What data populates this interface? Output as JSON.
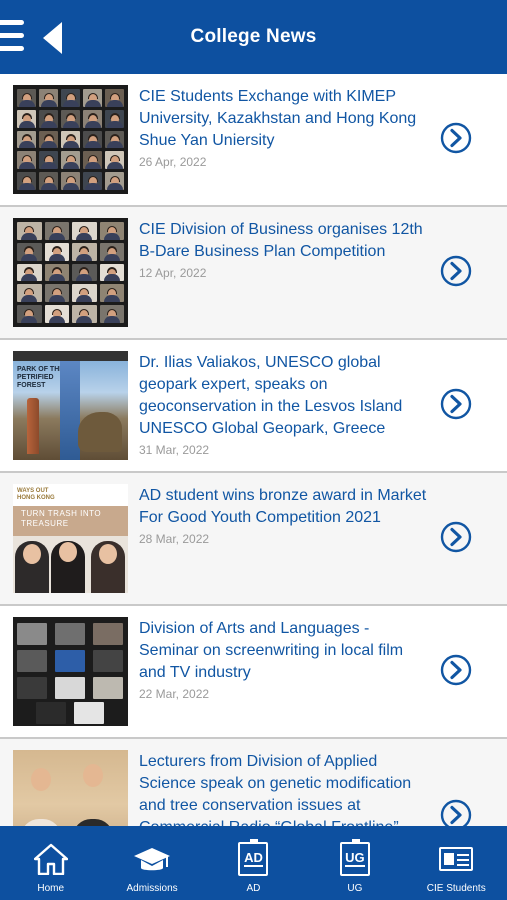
{
  "header": {
    "title": "College News",
    "menu_icon": "hamburger-icon",
    "back_icon": "back-arrow-icon"
  },
  "colors": {
    "brand": "#0d50a0",
    "title_text": "#1156a3",
    "date_text": "#9a9a9a"
  },
  "news": [
    {
      "title": "CIE Students Exchange with KIMEP University, Kazakhstan and Hong Kong Shue Yan Uniersity",
      "date": "26 Apr, 2022"
    },
    {
      "title": "CIE Division of Business organises 12th B-Dare Business Plan Competition",
      "date": "12 Apr, 2022"
    },
    {
      "title": "Dr. Ilias Valiakos, UNESCO global geopark expert, speaks on geoconservation in the Lesvos Island UNESCO Global Geopark, Greece",
      "date": "31 Mar, 2022"
    },
    {
      "title": "AD student wins bronze award in Market For Good Youth Competition 2021",
      "date": "28 Mar, 2022"
    },
    {
      "title": "Division of Arts and Languages - Seminar on screenwriting in local film and TV industry",
      "date": "22 Mar, 2022"
    },
    {
      "title": "Lecturers from Division of Applied Science speak on genetic modification and tree conservation issues at Commercial Radio “Global Frontline”",
      "date": ""
    }
  ],
  "thumbs": {
    "geo_caption": "PARK OF THE PETRIFIED FOREST",
    "trash_logo": "WAYS OUT HONG KONG",
    "trash_slogan": "TURN TRASH INTO TREASURE"
  },
  "tabbar": [
    {
      "label": "Home",
      "icon": "home-icon"
    },
    {
      "label": "Admissions",
      "icon": "graduation-cap-icon"
    },
    {
      "label": "AD",
      "icon": "ad-badge-icon",
      "badge": "AD"
    },
    {
      "label": "UG",
      "icon": "ug-badge-icon",
      "badge": "UG"
    },
    {
      "label": "CIE Students",
      "icon": "student-card-icon"
    }
  ]
}
